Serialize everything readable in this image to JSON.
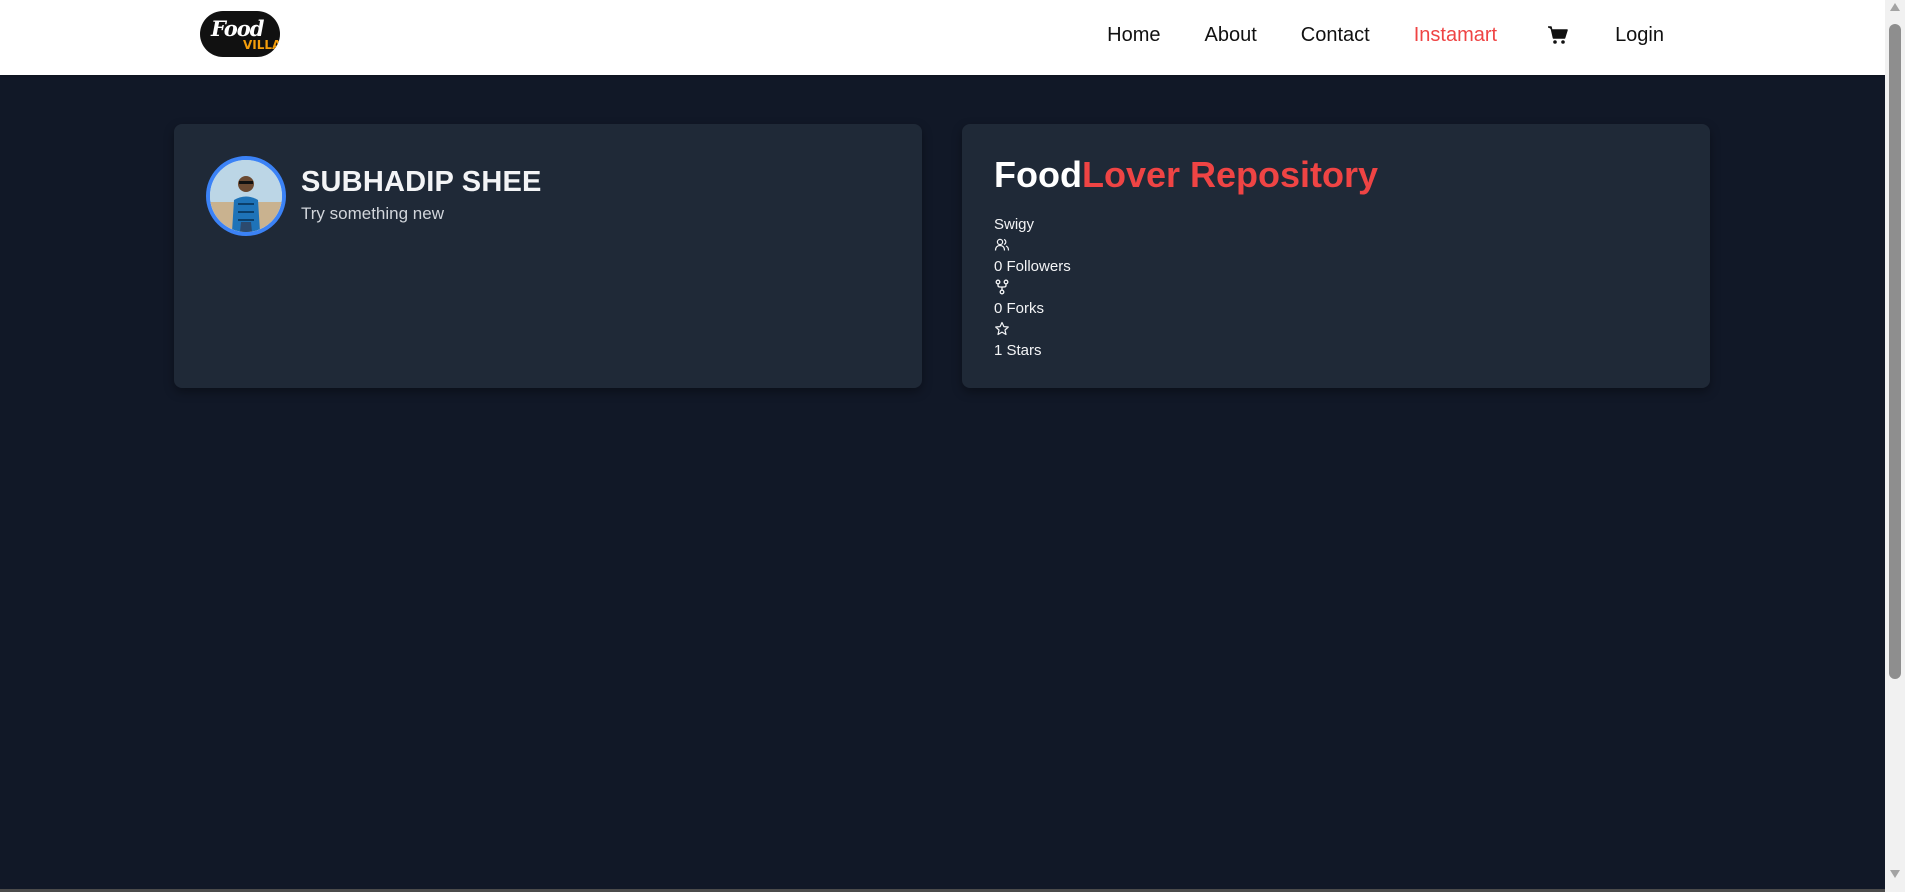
{
  "navbar": {
    "logo": {
      "food": "Food",
      "villa": "VILLA",
      "icon": "food-villa-logo"
    },
    "links": [
      {
        "label": "Home"
      },
      {
        "label": "About"
      },
      {
        "label": "Contact"
      },
      {
        "label": "Instamart"
      }
    ],
    "cart_icon": "cart-icon",
    "login_label": "Login",
    "accent_color": "#ef4444"
  },
  "profile": {
    "name": "SUBHADIP SHEE",
    "tagline": "Try something new",
    "avatar_icon": "avatar"
  },
  "repo": {
    "title_part1": "Food",
    "title_part2": "Lover Repository",
    "owner": "Swigy",
    "followers_label": "0 Followers",
    "forks_label": "0 Forks",
    "stars_label": "1 Stars",
    "followers_icon": "users-icon",
    "forks_icon": "fork-icon",
    "stars_icon": "star-icon"
  },
  "colors": {
    "page_bg": "#111827",
    "card_bg": "#1f2937",
    "avatar_border": "#3b82f6"
  }
}
